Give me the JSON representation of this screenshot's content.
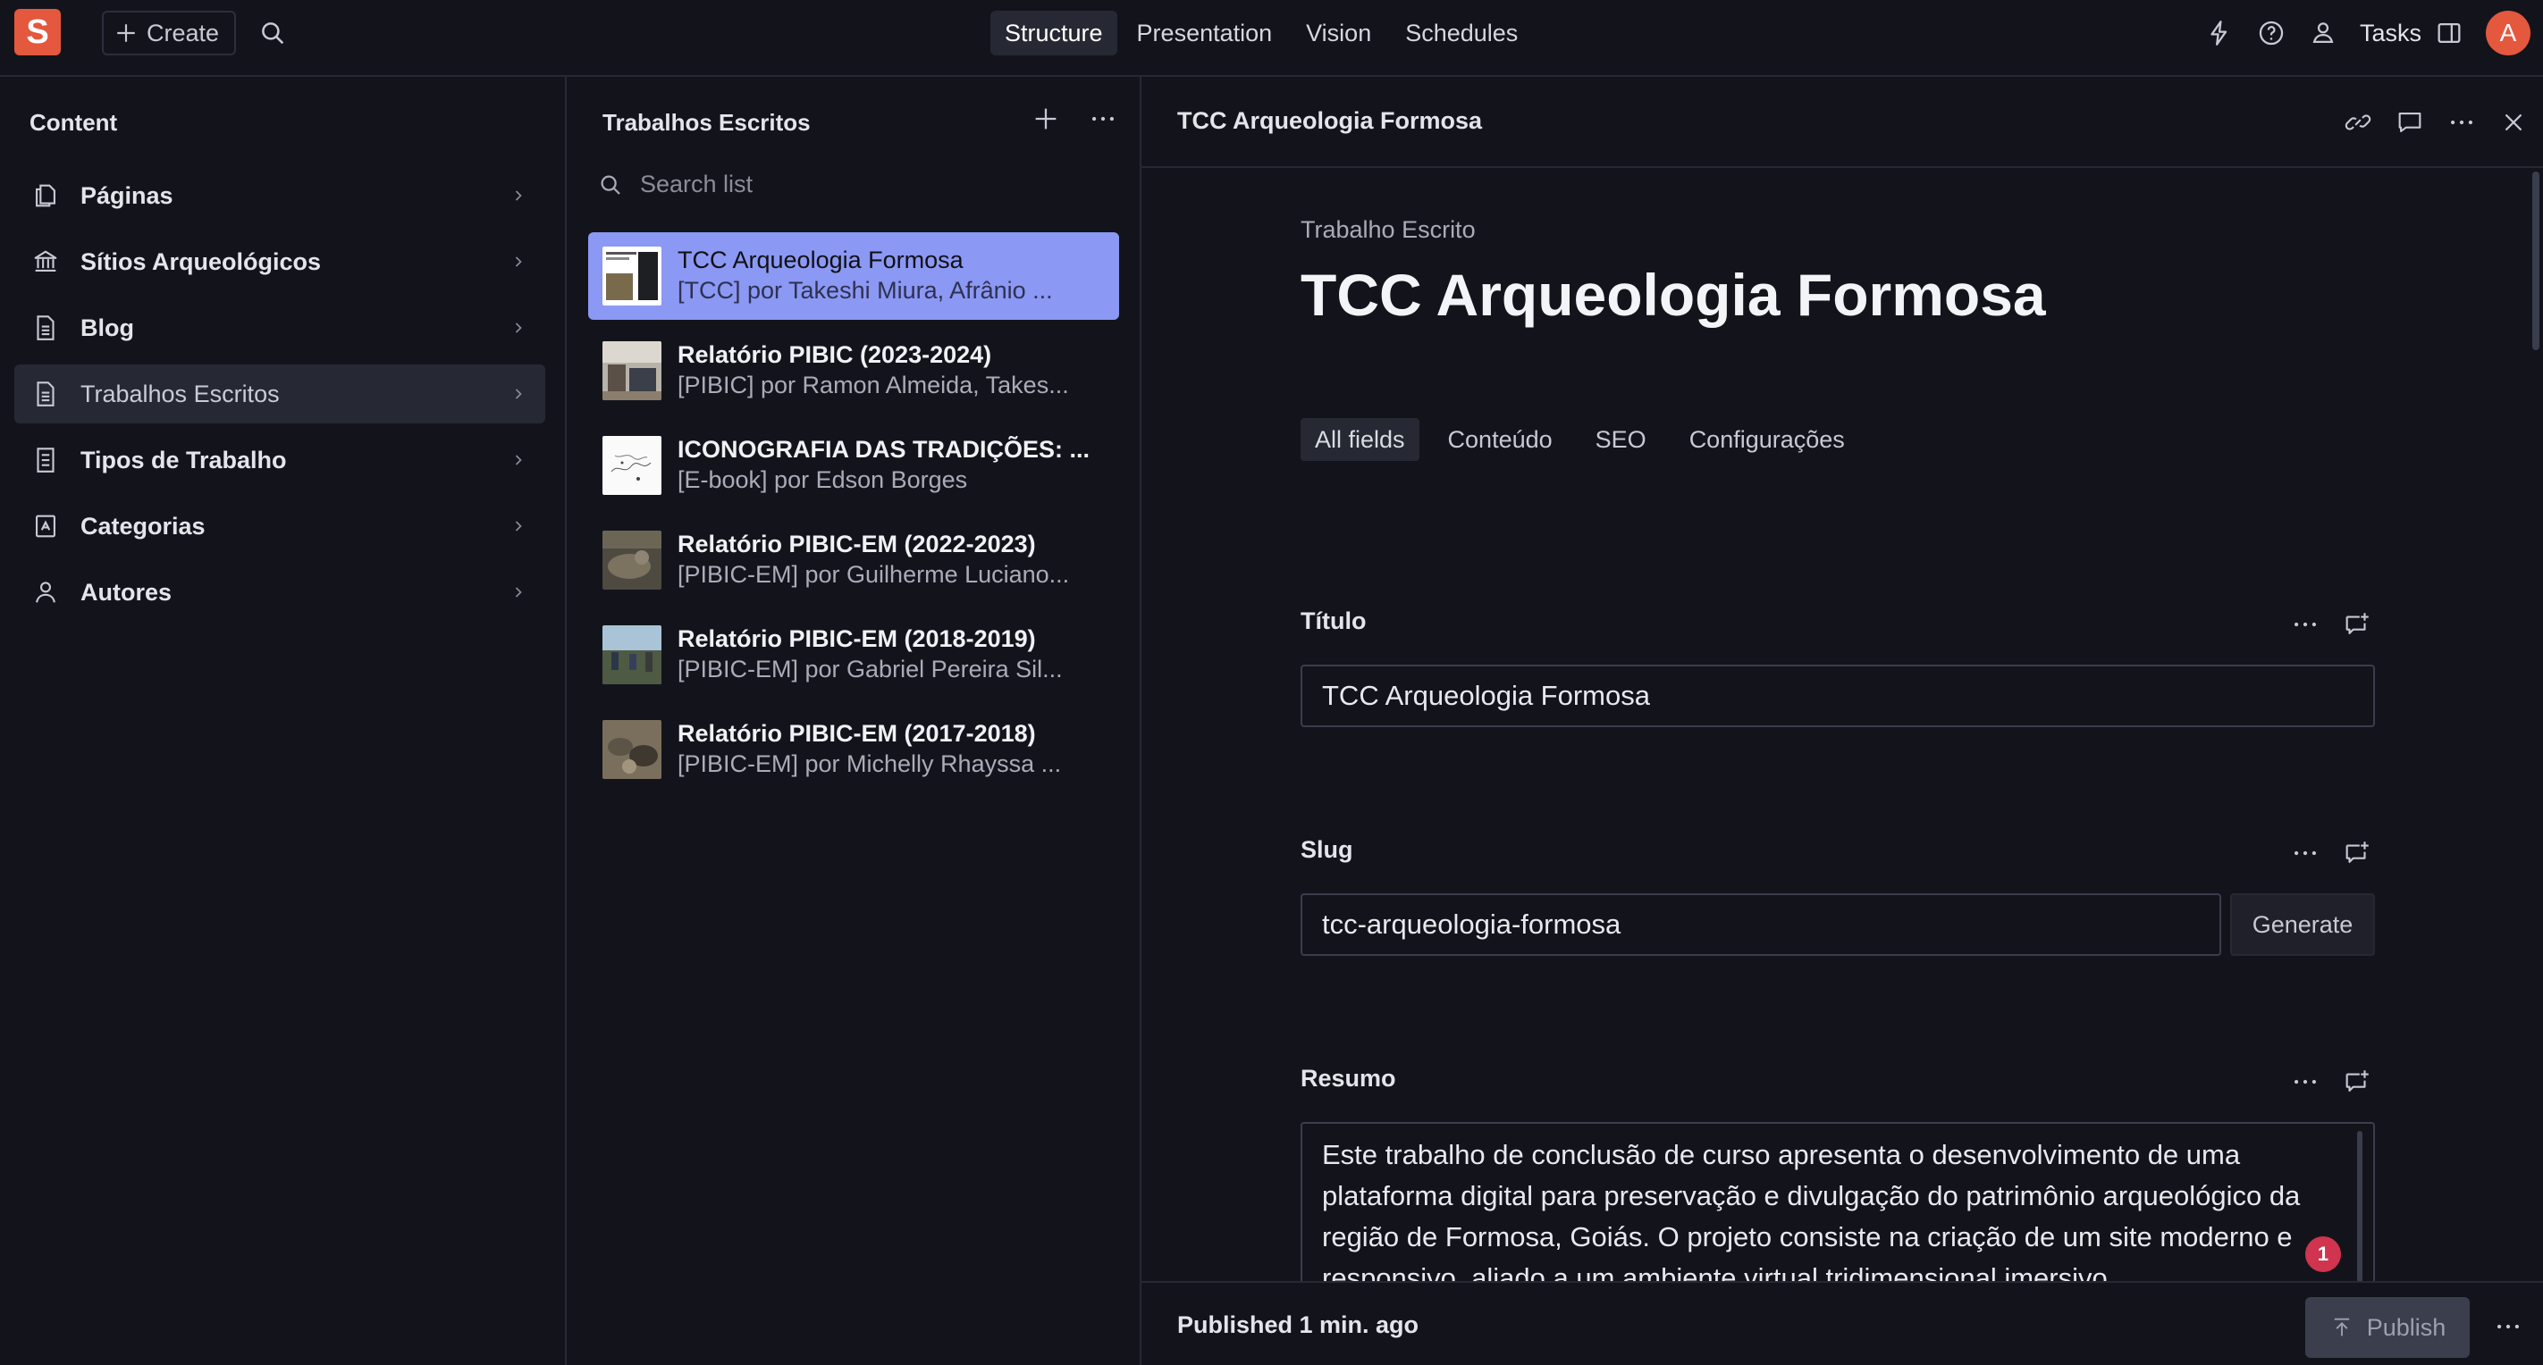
{
  "topbar": {
    "logo_letter": "S",
    "create_label": "Create",
    "tabs": [
      {
        "label": "Structure",
        "active": true
      },
      {
        "label": "Presentation",
        "active": false
      },
      {
        "label": "Vision",
        "active": false
      },
      {
        "label": "Schedules",
        "active": false
      }
    ],
    "tasks_label": "Tasks",
    "avatar_letter": "A"
  },
  "content_pane": {
    "title": "Content",
    "items": [
      {
        "label": "Páginas",
        "icon": "pages-icon"
      },
      {
        "label": "Sítios Arqueológicos",
        "icon": "bank-icon"
      },
      {
        "label": "Blog",
        "icon": "document-icon"
      },
      {
        "label": "Trabalhos Escritos",
        "icon": "document-icon",
        "active": true
      },
      {
        "label": "Tipos de Trabalho",
        "icon": "document-icon"
      },
      {
        "label": "Categorias",
        "icon": "tag-icon"
      },
      {
        "label": "Autores",
        "icon": "user-icon"
      }
    ]
  },
  "list_pane": {
    "title": "Trabalhos Escritos",
    "search_placeholder": "Search list",
    "items": [
      {
        "title": "TCC Arqueologia Formosa",
        "subtitle": "[TCC] por Takeshi Miura, Afrânio ...",
        "selected": true
      },
      {
        "title": "Relatório PIBIC (2023-2024)",
        "subtitle": "[PIBIC] por Ramon Almeida, Takes..."
      },
      {
        "title": "ICONOGRAFIA DAS TRADIÇÕES: ...",
        "subtitle": "[E-book] por Edson Borges"
      },
      {
        "title": "Relatório PIBIC-EM (2022-2023)",
        "subtitle": "[PIBIC-EM] por Guilherme Luciano..."
      },
      {
        "title": "Relatório PIBIC-EM (2018-2019)",
        "subtitle": "[PIBIC-EM] por Gabriel Pereira Sil..."
      },
      {
        "title": "Relatório PIBIC-EM (2017-2018)",
        "subtitle": "[PIBIC-EM] por Michelly Rhayssa ..."
      }
    ]
  },
  "document": {
    "header_title": "TCC Arqueologia Formosa",
    "kicker": "Trabalho Escrito",
    "title": "TCC Arqueologia Formosa",
    "tabs": [
      {
        "label": "All fields",
        "active": true
      },
      {
        "label": "Conteúdo"
      },
      {
        "label": "SEO"
      },
      {
        "label": "Configurações"
      }
    ],
    "fields": {
      "titulo": {
        "label": "Título",
        "value": "TCC Arqueologia Formosa"
      },
      "slug": {
        "label": "Slug",
        "value": "tcc-arqueologia-formosa",
        "generate_label": "Generate"
      },
      "resumo": {
        "label": "Resumo",
        "value": "Este trabalho de conclusão de curso apresenta o desenvolvimento de uma plataforma digital para preservação e divulgação do patrimônio arqueológico da região de Formosa, Goiás. O projeto consiste na criação de um site moderno e responsivo, aliado a um ambiente virtual tridimensional imersivo"
      }
    },
    "badge_count": "1",
    "footer": {
      "status": "Published 1 min. ago",
      "publish_label": "Publish"
    }
  },
  "colors": {
    "background": "#13141b",
    "accent_selected": "#8b98f4",
    "brand": "#e4583e",
    "badge": "#d0344e"
  }
}
